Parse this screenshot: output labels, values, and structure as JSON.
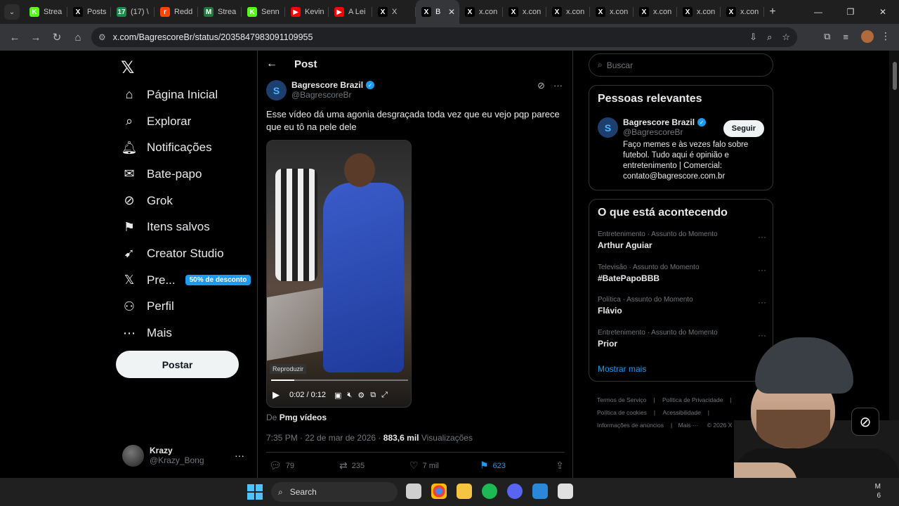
{
  "browser": {
    "tabs": [
      {
        "label": "Strea",
        "fav": "K",
        "color": "#53fc18"
      },
      {
        "label": "Posts",
        "fav": "X",
        "color": "#000000"
      },
      {
        "label": "(17) \\",
        "fav": "17",
        "color": "#1b8d4b"
      },
      {
        "label": "Redd",
        "fav": "r",
        "color": "#ff4500"
      },
      {
        "label": "Strea",
        "fav": "M",
        "color": "#1f7a3d"
      },
      {
        "label": "Senn",
        "fav": "K",
        "color": "#53fc18"
      },
      {
        "label": "Kevin",
        "fav": "▶",
        "color": "#ff0000"
      },
      {
        "label": "A Lei",
        "fav": "▶",
        "color": "#ff0000"
      },
      {
        "label": "X",
        "fav": "X",
        "color": "#000000"
      },
      {
        "label": "B",
        "fav": "X",
        "color": "#000000",
        "active": true
      },
      {
        "label": "x.con",
        "fav": "X",
        "color": "#000000"
      },
      {
        "label": "x.con",
        "fav": "X",
        "color": "#000000"
      },
      {
        "label": "x.con",
        "fav": "X",
        "color": "#000000"
      },
      {
        "label": "x.con",
        "fav": "X",
        "color": "#000000"
      },
      {
        "label": "x.con",
        "fav": "X",
        "color": "#000000"
      },
      {
        "label": "x.con",
        "fav": "X",
        "color": "#000000"
      },
      {
        "label": "x.con",
        "fav": "X",
        "color": "#000000"
      }
    ],
    "url": "x.com/BagrescoreBr/status/2035847983091109955"
  },
  "sidebar": {
    "logo": "𝕏",
    "items": [
      {
        "label": "Página Inicial",
        "icon": "⌂",
        "name": "home"
      },
      {
        "label": "Explorar",
        "icon": "⌕",
        "name": "explore"
      },
      {
        "label": "Notificações",
        "icon": "🔔︎",
        "name": "notifications"
      },
      {
        "label": "Bate-papo",
        "icon": "✉",
        "name": "chat"
      },
      {
        "label": "Grok",
        "icon": "⊘",
        "name": "grok"
      },
      {
        "label": "Itens salvos",
        "icon": "⚑",
        "name": "bookmarks"
      },
      {
        "label": "Creator Studio",
        "icon": "➹",
        "name": "creator-studio"
      },
      {
        "label": "Pre...",
        "icon": "𝕏",
        "name": "premium",
        "badge": "50% de desconto"
      },
      {
        "label": "Perfil",
        "icon": "⚇",
        "name": "profile"
      },
      {
        "label": "Mais",
        "icon": "⋯",
        "name": "more"
      }
    ],
    "post_button": "Postar",
    "me": {
      "name": "Krazy",
      "handle": "@Krazy_Bong"
    }
  },
  "post": {
    "header_title": "Post",
    "author_name": "Bagrescore Brazil",
    "author_handle": "@BagrescoreBr",
    "text": "Esse vídeo dá uma agonia desgraçada toda vez que eu vejo pqp parece que eu tô na pele dele",
    "video": {
      "tooltip": "Reproduzir",
      "time": "0:02 / 0:12",
      "progress": 0.17
    },
    "from_prefix": "De",
    "from_source": "Pmg vídeos",
    "timestamp": "7:35 PM · 22 de mar de 2026 ·",
    "views_count": "883,6 mil",
    "views_label": "Visualizações",
    "stats": {
      "replies": "79",
      "reposts": "235",
      "likes": "7 mil",
      "bookmarks": "623"
    }
  },
  "right": {
    "search_placeholder": "Buscar",
    "relevant": {
      "title": "Pessoas relevantes",
      "name": "Bagrescore Brazil",
      "handle": "@BagrescoreBr",
      "bio": "Faço memes e às vezes falo sobre futebol. Tudo aqui é opinião e entretenimento | Comercial: contato@bagrescore.com.br",
      "follow": "Seguir"
    },
    "trends": {
      "title": "O que está acontecendo",
      "items": [
        {
          "meta": "Entretenimento · Assunto do Momento",
          "name": "Arthur Aguiar"
        },
        {
          "meta": "Televisão · Assunto do Momento",
          "name": "#BatePapoBBB"
        },
        {
          "meta": "Política · Assunto do Momento",
          "name": "Flávio"
        },
        {
          "meta": "Entretenimento · Assunto do Momento",
          "name": "Prior"
        }
      ],
      "show_more": "Mostrar mais"
    },
    "footer": {
      "terms": "Termos de Serviço",
      "privacy": "Política de Privacidade",
      "cookies": "Política de cookies",
      "accessibility": "Acessibilidade",
      "ads": "Informações de anúncios",
      "more": "Mais ···",
      "copyright": "© 2026 X Corp."
    }
  },
  "taskbar": {
    "search": "Search",
    "clock_line1": "M",
    "clock_line2": "6"
  },
  "colors": {
    "accent": "#1d9bf0",
    "background": "#000000",
    "border": "#2f3336"
  }
}
